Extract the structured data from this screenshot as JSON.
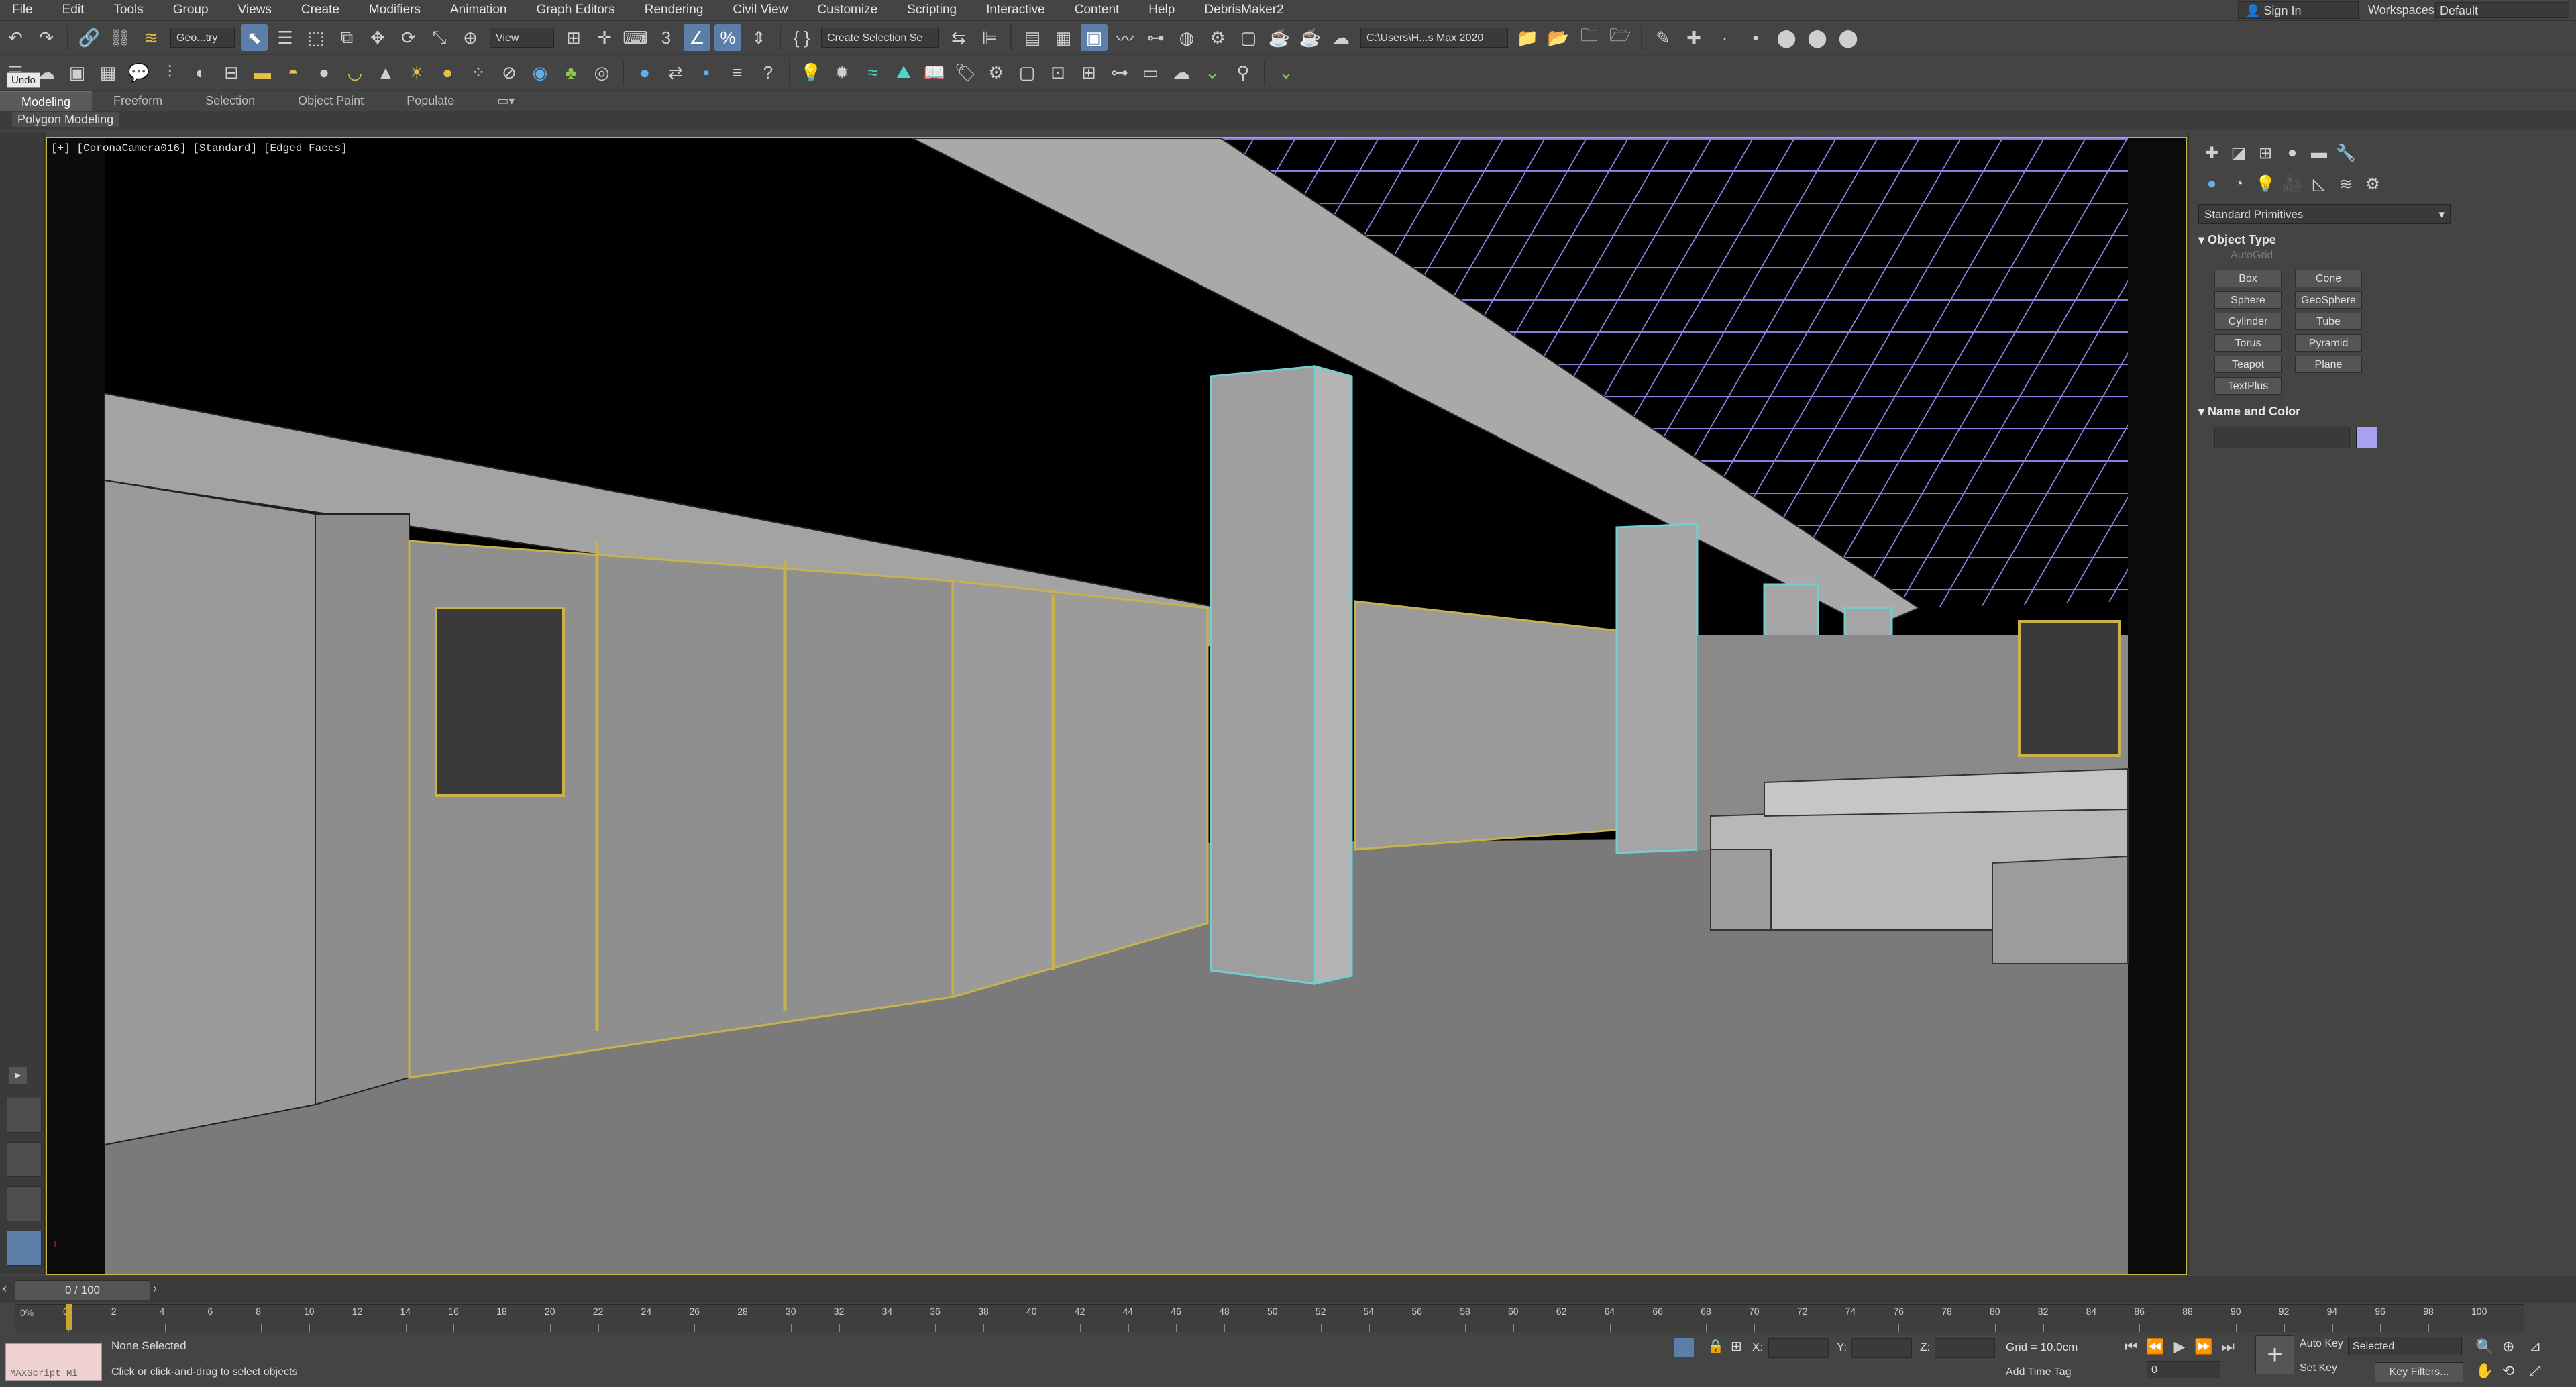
{
  "menu": [
    "File",
    "Edit",
    "Tools",
    "Group",
    "Views",
    "Create",
    "Modifiers",
    "Animation",
    "Graph Editors",
    "Rendering",
    "Civil View",
    "Customize",
    "Scripting",
    "Interactive",
    "Content",
    "Help",
    "DebrisMaker2"
  ],
  "account": {
    "signin": "Sign In",
    "workspaces_label": "Workspaces:",
    "workspace": "Default"
  },
  "toolbar": {
    "selection_filter": "Geo...try",
    "ref_coord": "View",
    "named_selection": "Create Selection Se",
    "project_path": "C:\\Users\\H...s Max 2020"
  },
  "tooltip": "Undo",
  "ribbon": {
    "tabs": [
      "Modeling",
      "Freeform",
      "Selection",
      "Object Paint",
      "Populate"
    ],
    "active_tab": "Modeling",
    "panel_label": "Polygon Modeling"
  },
  "viewport": {
    "label": "[+] [CoronaCamera016] [Standard] [Edged Faces]"
  },
  "command_panel": {
    "category": "Standard Primitives",
    "object_type_title": "Object Type",
    "autogrid": "AutoGrid",
    "buttons": [
      "Box",
      "Cone",
      "Sphere",
      "GeoSphere",
      "Cylinder",
      "Tube",
      "Torus",
      "Pyramid",
      "Teapot",
      "Plane",
      "TextPlus"
    ],
    "name_color_title": "Name and Color",
    "object_color": "#a8a0f0"
  },
  "timeline": {
    "slider": "0 / 100",
    "ticks": [
      0,
      2,
      4,
      6,
      8,
      10,
      12,
      14,
      16,
      18,
      20,
      22,
      24,
      26,
      28,
      30,
      32,
      34,
      36,
      38,
      40,
      42,
      44,
      46,
      48,
      50,
      52,
      54,
      56,
      58,
      60,
      62,
      64,
      66,
      68,
      70,
      72,
      74,
      76,
      78,
      80,
      82,
      84,
      86,
      88,
      90,
      92,
      94,
      96,
      98,
      100
    ],
    "ruler_start_label": "0%"
  },
  "status": {
    "maxscript": "MAXScript Mi",
    "selection": "None Selected",
    "prompt": "Click or click-and-drag to select objects",
    "x_label": "X:",
    "y_label": "Y:",
    "z_label": "Z:",
    "grid": "Grid = 10.0cm",
    "add_time_tag": "Add Time Tag",
    "current_frame": "0",
    "auto_key": "Auto Key",
    "set_key": "Set Key",
    "key_mode": "Selected",
    "key_filters": "Key Filters..."
  },
  "colors": {
    "viewport_border": "#c9b24a",
    "ceiling_grid": "#8c82e6",
    "active_button": "#5b7fa8"
  }
}
